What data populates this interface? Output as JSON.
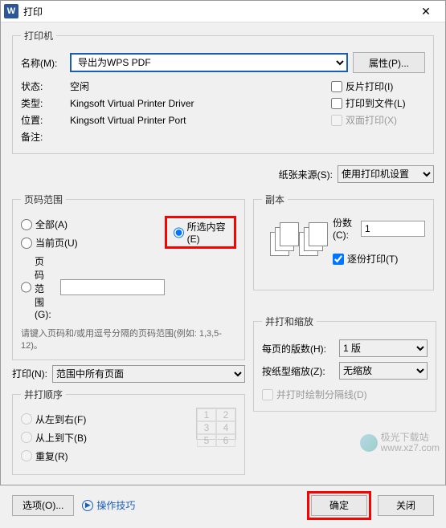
{
  "window": {
    "title": "打印",
    "icon_letter": "W"
  },
  "printer": {
    "group": "打印机",
    "name_label": "名称(M):",
    "name_value": "导出为WPS PDF",
    "properties_btn": "属性(P)...",
    "status_label": "状态:",
    "status_value": "空闲",
    "type_label": "类型:",
    "type_value": "Kingsoft Virtual Printer Driver",
    "where_label": "位置:",
    "where_value": "Kingsoft Virtual Printer Port",
    "comment_label": "备注:",
    "comment_value": "",
    "reverse": "反片打印(I)",
    "to_file": "打印到文件(L)",
    "duplex": "双面打印(X)"
  },
  "paper": {
    "source_label": "纸张来源(S):",
    "source_value": "使用打印机设置"
  },
  "range": {
    "group": "页码范围",
    "all": "全部(A)",
    "current": "当前页(U)",
    "selection": "所选内容(E)",
    "pages": "页码范围(G):",
    "hint": "请键入页码和/或用逗号分隔的页码范围(例如: 1,3,5-12)。"
  },
  "copies": {
    "group": "副本",
    "count_label": "份数(C):",
    "count_value": "1",
    "collate": "逐份打印(T)"
  },
  "print_what": {
    "label": "打印(N):",
    "value": "范围中所有页面"
  },
  "order": {
    "group": "并打顺序",
    "lr": "从左到右(F)",
    "tb": "从上到下(B)",
    "repeat": "重复(R)"
  },
  "scale": {
    "group": "并打和缩放",
    "pages_label": "每页的版数(H):",
    "pages_value": "1 版",
    "scale_label": "按纸型缩放(Z):",
    "scale_value": "无缩放",
    "sep": "并打时绘制分隔线(D)"
  },
  "footer": {
    "options": "选项(O)...",
    "tips": "操作技巧",
    "ok": "确定",
    "close": "关闭"
  },
  "watermark": {
    "name": "极光下载站",
    "url": "www.xz7.com"
  }
}
